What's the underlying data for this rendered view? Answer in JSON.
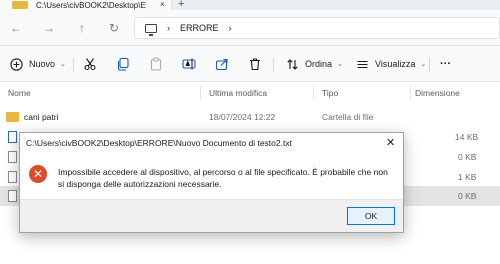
{
  "tab": {
    "title": "C:\\Users\\civBOOK2\\Desktop\\E",
    "close": "×",
    "add": "+"
  },
  "nav": {
    "back": "←",
    "forward": "→",
    "up": "↑",
    "refresh": "↻"
  },
  "address": {
    "sep1": "›",
    "folder": "ERRORE",
    "sep2": "›"
  },
  "toolbar": {
    "new_label": "Nuovo",
    "sort_label": "Ordina",
    "view_label": "Visualizza",
    "more": "···"
  },
  "columns": [
    "Nome",
    "Ultima modifica",
    "Tipo",
    "Dimensione"
  ],
  "rows": [
    {
      "name": "cani patri",
      "date": "18/07/2024 12:22",
      "type": "Cartella di file",
      "size": ""
    },
    {
      "name": "",
      "date": "",
      "type": "",
      "size": "14 KB"
    },
    {
      "name": "",
      "date": "",
      "type": "",
      "size": "0 KB"
    },
    {
      "name": "",
      "date": "",
      "type": "",
      "size": "1 KB"
    },
    {
      "name": "",
      "date": "",
      "type": "",
      "size": "0 KB"
    }
  ],
  "dialog": {
    "title": "C:\\Users\\civBOOK2\\Desktop\\ERRORE\\Nuovo Documento di testo2.txt",
    "close": "✕",
    "message": "Impossibile accedere al dispositivo, al percorso o al file specificato. È probabile che non si disponga delle autorizzazioni necessarie.",
    "ok_label": "OK",
    "error_glyph": "✕"
  }
}
